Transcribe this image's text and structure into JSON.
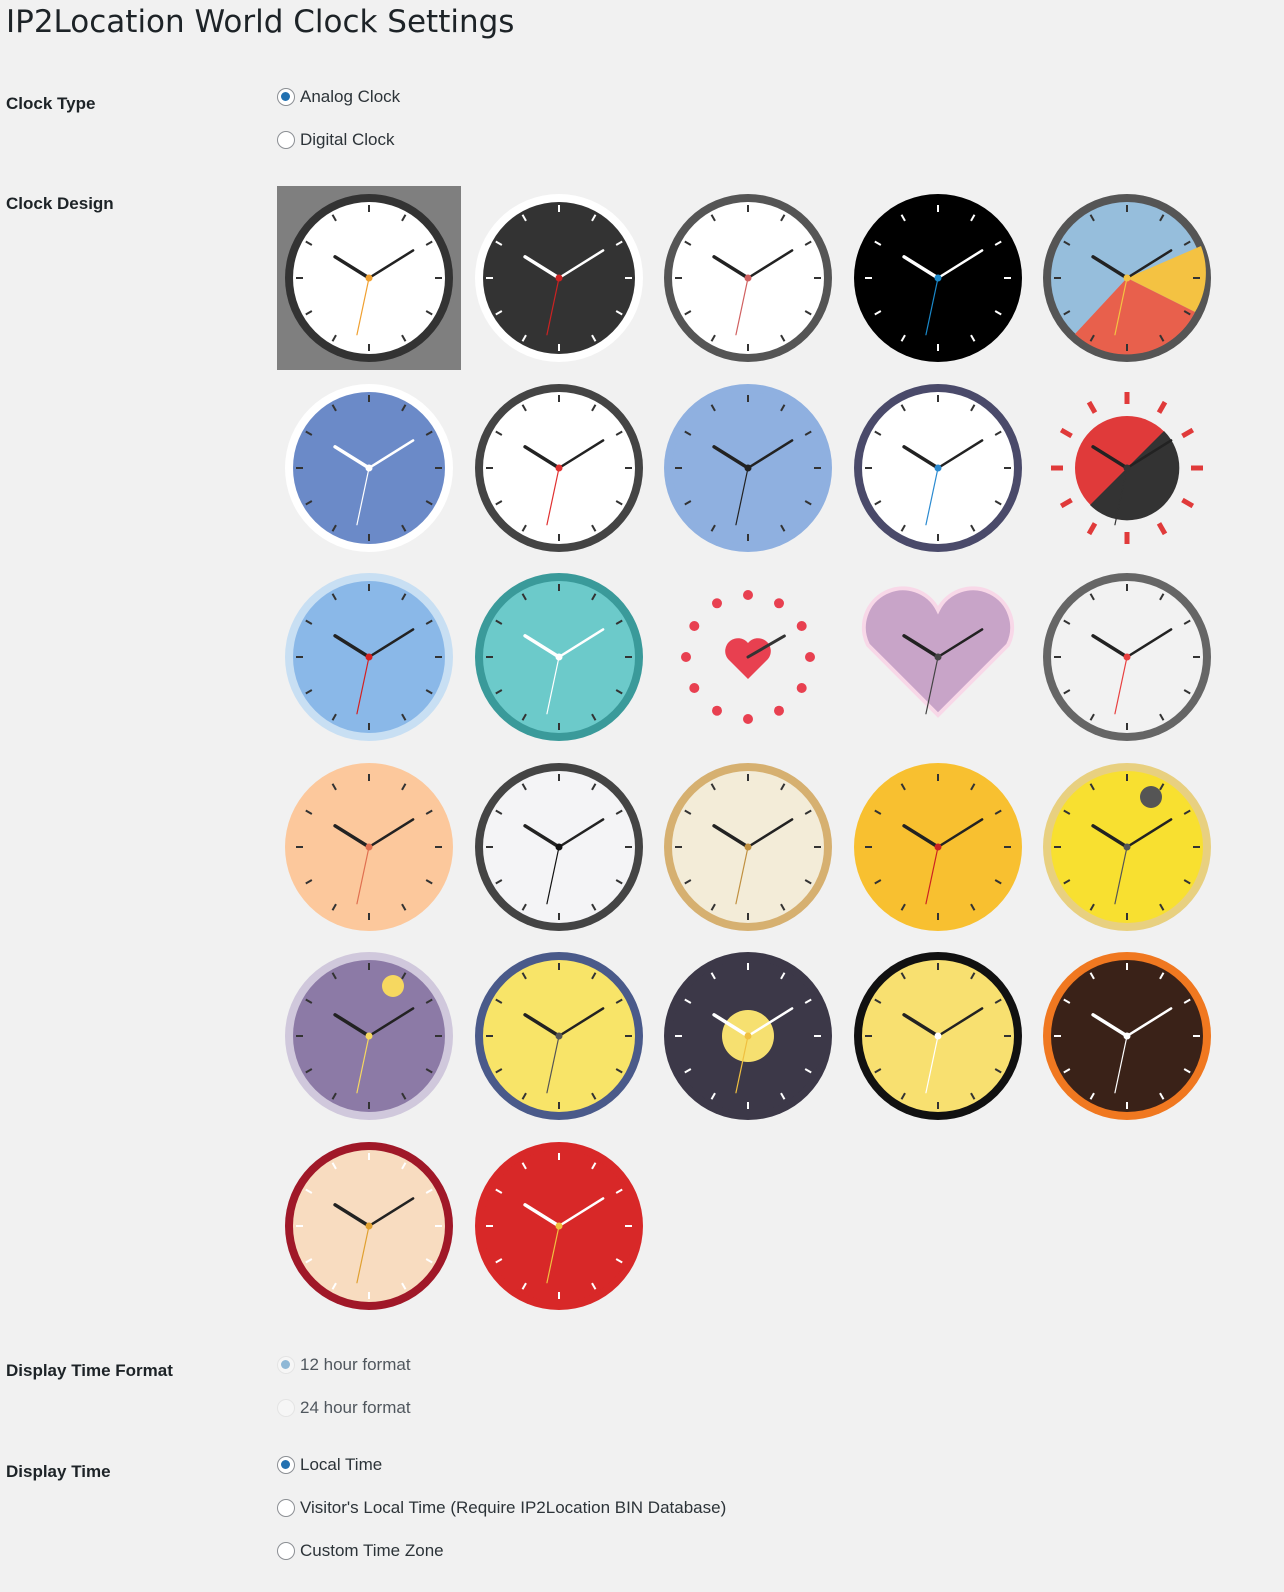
{
  "page_title": "IP2Location World Clock Settings",
  "clock_type": {
    "label": "Clock Type",
    "options": [
      {
        "label": "Analog Clock",
        "checked": true
      },
      {
        "label": "Digital Clock",
        "checked": false
      }
    ]
  },
  "clock_design": {
    "label": "Clock Design",
    "selected_index": 0,
    "designs": [
      {
        "icon": "classic-white-clock-icon",
        "colors": {
          "face": "#ffffff",
          "rim": "#333333",
          "accent": "#f0a030"
        }
      },
      {
        "icon": "black-numeral-clock-icon",
        "colors": {
          "face": "#333333",
          "rim": "#ffffff",
          "accent": "#cc2222"
        }
      },
      {
        "icon": "minimal-white-clock-icon",
        "colors": {
          "face": "#ffffff",
          "rim": "#555555",
          "accent": "#d06060"
        }
      },
      {
        "icon": "black-dotted-clock-icon",
        "colors": {
          "face": "#000000",
          "rim": "#000000",
          "accent": "#1a88c9"
        }
      },
      {
        "icon": "tricolor-clock-icon",
        "colors": {
          "face": "#96bedc",
          "rim": "#555555",
          "accent": "#f4c242"
        }
      },
      {
        "icon": "blue-clock-icon",
        "colors": {
          "face": "#6b8ac8",
          "rim": "#ffffff",
          "accent": "#ffffff"
        }
      },
      {
        "icon": "red-tick-clock-icon",
        "colors": {
          "face": "#ffffff",
          "rim": "#444444",
          "accent": "#e03030"
        }
      },
      {
        "icon": "roman-blue-clock-icon",
        "colors": {
          "face": "#8fb0e0",
          "rim": "#8fb0e0",
          "accent": "#222222"
        }
      },
      {
        "icon": "navy-rim-clock-icon",
        "colors": {
          "face": "#ffffff",
          "rim": "#4a4a6a",
          "accent": "#2a8ad0"
        }
      },
      {
        "icon": "sun-clock-icon",
        "colors": {
          "face": "#e03a3a",
          "rim": "#e03a3a",
          "accent": "#333333"
        }
      },
      {
        "icon": "christmas-clock-icon",
        "colors": {
          "face": "#8ab8e8",
          "rim": "#c8dff3",
          "accent": "#d42020"
        }
      },
      {
        "icon": "snowflake-clock-icon",
        "colors": {
          "face": "#6ccaca",
          "rim": "#3a9a9a",
          "accent": "#ffffff"
        }
      },
      {
        "icon": "hearts-clock-icon",
        "colors": {
          "face": "#f1f1f1",
          "rim": "#f1f1f1",
          "accent": "#e84050"
        }
      },
      {
        "icon": "heart-shaped-clock-icon",
        "colors": {
          "face": "#c8a4c8",
          "rim": "#f8d8e8",
          "accent": "#444444"
        }
      },
      {
        "icon": "easter-eggs-clock-icon",
        "colors": {
          "face": "#f2f2f2",
          "rim": "#666666",
          "accent": "#e84040"
        }
      },
      {
        "icon": "easter-bunny-clock-icon",
        "colors": {
          "face": "#fcc89c",
          "rim": "#fcc89c",
          "accent": "#e07050"
        }
      },
      {
        "icon": "roman-white-clock-icon",
        "colors": {
          "face": "#f4f4f6",
          "rim": "#444444",
          "accent": "#111111"
        }
      },
      {
        "icon": "steampunk-gears-clock-icon",
        "colors": {
          "face": "#f3ecd8",
          "rim": "#d6b070",
          "accent": "#c09040"
        }
      },
      {
        "icon": "mooncake-clock-icon",
        "colors": {
          "face": "#f8c030",
          "rim": "#f8c030",
          "accent": "#cc2222"
        }
      },
      {
        "icon": "yellow-moon-clock-icon",
        "colors": {
          "face": "#f8e030",
          "rim": "#e8d080",
          "accent": "#555555"
        }
      },
      {
        "icon": "purple-night-clock-icon",
        "colors": {
          "face": "#8c7aa6",
          "rim": "#d0c8dc",
          "accent": "#f6d860"
        }
      },
      {
        "icon": "moon-rabbits-clock-icon",
        "colors": {
          "face": "#f8e468",
          "rim": "#4a5a8a",
          "accent": "#555555"
        }
      },
      {
        "icon": "lantern-festival-clock-icon",
        "colors": {
          "face": "#3c3848",
          "rim": "#3c3848",
          "accent": "#f0c040"
        }
      },
      {
        "icon": "haunted-castle-clock-icon",
        "colors": {
          "face": "#f8e070",
          "rim": "#111111",
          "accent": "#ffffff"
        }
      },
      {
        "icon": "pumpkin-clock-icon",
        "colors": {
          "face": "#3a2218",
          "rim": "#f07820",
          "accent": "#ffffff"
        }
      },
      {
        "icon": "chinese-new-year-clock-icon",
        "colors": {
          "face": "#f8dcc0",
          "rim": "#a01828",
          "accent": "#e0a030"
        }
      },
      {
        "icon": "red-lantern-clock-icon",
        "colors": {
          "face": "#d82828",
          "rim": "#d82828",
          "accent": "#f0c040"
        }
      }
    ]
  },
  "time_format": {
    "label": "Display Time Format",
    "options": [
      {
        "label": "12 hour format",
        "checked": true
      },
      {
        "label": "24 hour format",
        "checked": false
      }
    ]
  },
  "display_time": {
    "label": "Display Time",
    "options": [
      {
        "label": "Local Time",
        "checked": true
      },
      {
        "label": "Visitor's Local Time (Require IP2Location BIN Database)",
        "checked": false
      },
      {
        "label": "Custom Time Zone",
        "checked": false
      }
    ]
  }
}
